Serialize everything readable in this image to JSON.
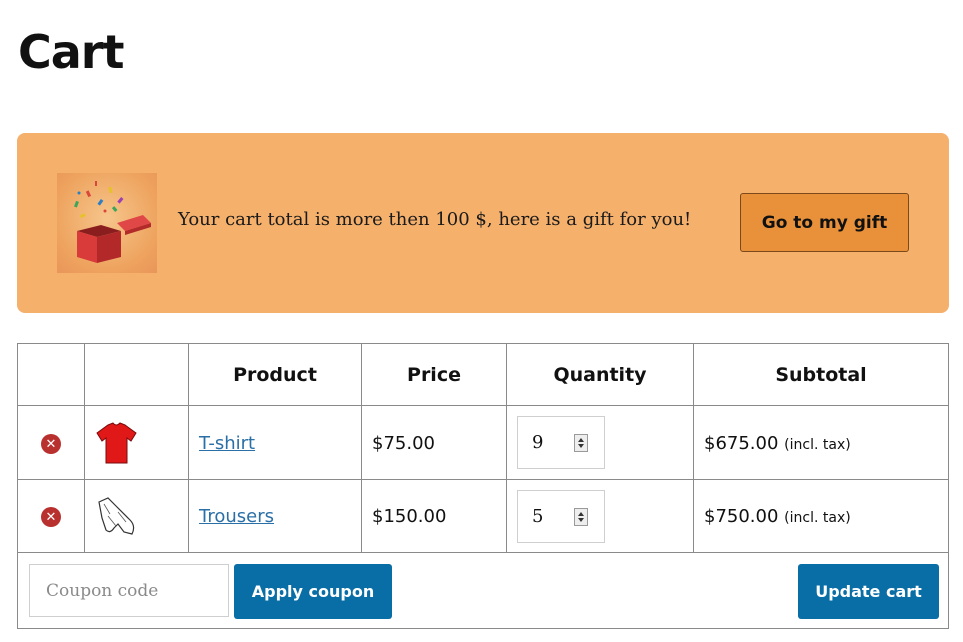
{
  "page": {
    "title": "Cart"
  },
  "gift_banner": {
    "message": "Your cart total is more then 100 $, here is a gift for you!",
    "button_label": "Go to my gift",
    "image_icon": "gift-box-icon"
  },
  "cart_table": {
    "headers": [
      "",
      "",
      "Product",
      "Price",
      "Quantity",
      "Subtotal"
    ],
    "rows": [
      {
        "remove_icon": "remove-icon",
        "thumbnail_icon": "tshirt-icon",
        "product": "T-shirt",
        "price": "$75.00",
        "quantity": "9",
        "subtotal": "$675.00",
        "tax_note": "(incl. tax)"
      },
      {
        "remove_icon": "remove-icon",
        "thumbnail_icon": "trousers-icon",
        "product": "Trousers",
        "price": "$150.00",
        "quantity": "5",
        "subtotal": "$750.00",
        "tax_note": "(incl. tax)"
      }
    ],
    "coupon_placeholder": "Coupon code",
    "apply_coupon_label": "Apply coupon",
    "update_cart_label": "Update cart"
  },
  "colors": {
    "banner_bg": "#f5b06c",
    "gift_button_bg": "#e8913a",
    "primary_button_bg": "#0a6ea6",
    "link": "#2a6fa6",
    "remove_icon": "#b8312f"
  }
}
